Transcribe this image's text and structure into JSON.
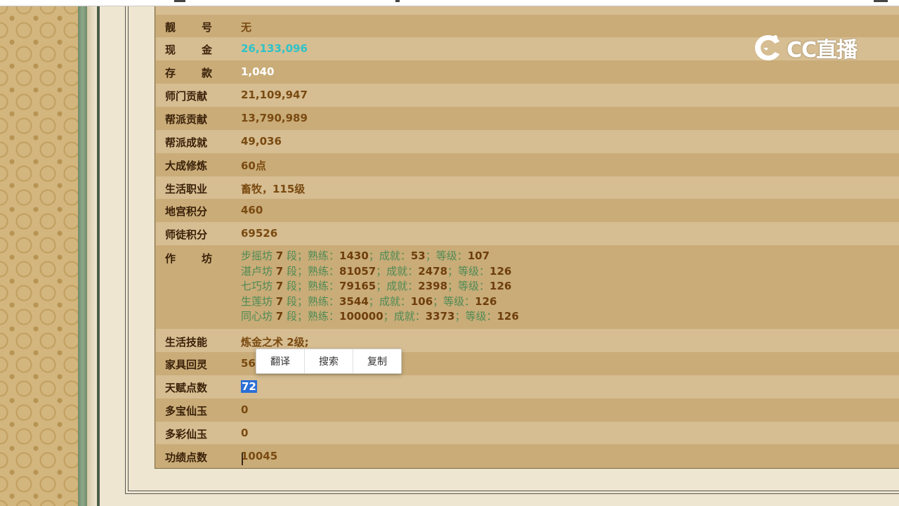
{
  "logo": {
    "text": "CC直播"
  },
  "rows": [
    {
      "label": "靓号",
      "value": "无"
    },
    {
      "label": "现金",
      "value": "26,133,096"
    },
    {
      "label": "存款",
      "value": "1,040"
    },
    {
      "label": "师门贡献",
      "value": "21,109,947"
    },
    {
      "label": "帮派贡献",
      "value": "13,790,989"
    },
    {
      "label": "帮派成就",
      "value": "49,036"
    },
    {
      "label": "大成修炼",
      "value": "60点"
    },
    {
      "label": "生活职业",
      "value": "畜牧，115级"
    },
    {
      "label": "地宫积分",
      "value": "460"
    },
    {
      "label": "师徒积分",
      "value": "69526"
    },
    {
      "label": "作坊"
    },
    {
      "label": "生活技能",
      "value": "炼金之术 2级;"
    },
    {
      "label": "家具回灵",
      "value": "56"
    },
    {
      "label": "天赋点数",
      "value": "72"
    },
    {
      "label": "多宝仙玉",
      "value": "0"
    },
    {
      "label": "多彩仙玉",
      "value": "0"
    },
    {
      "label": "功绩点数",
      "value": "10045"
    }
  ],
  "workshop": {
    "tokens": {
      "duan": "段；",
      "shulian": "熟练：",
      "chengjiu": "成就：",
      "dengji": "等级："
    },
    "lines": [
      {
        "name": "步摇坊",
        "level": "7",
        "skill": "1430",
        "achievement": "53",
        "grade": "107"
      },
      {
        "name": "湛卢坊",
        "level": "7",
        "skill": "81057",
        "achievement": "2478",
        "grade": "126"
      },
      {
        "name": "七巧坊",
        "level": "7",
        "skill": "79165",
        "achievement": "2398",
        "grade": "126"
      },
      {
        "name": "生莲坊",
        "level": "7",
        "skill": "3544",
        "achievement": "106",
        "grade": "126"
      },
      {
        "name": "同心坊",
        "level": "7",
        "skill": "100000",
        "achievement": "3373",
        "grade": "126"
      }
    ]
  },
  "context_menu": {
    "translate": "翻译",
    "search": "搜索",
    "copy": "复制"
  },
  "colors": {
    "panel_dark": "#c9ac78",
    "panel_light": "#d6bd92",
    "label": "#3a2108",
    "value": "#7a4a10",
    "cash": "#2cc3c9",
    "workshop_text": "#4f8a54",
    "selection": "#2a6fd6"
  }
}
